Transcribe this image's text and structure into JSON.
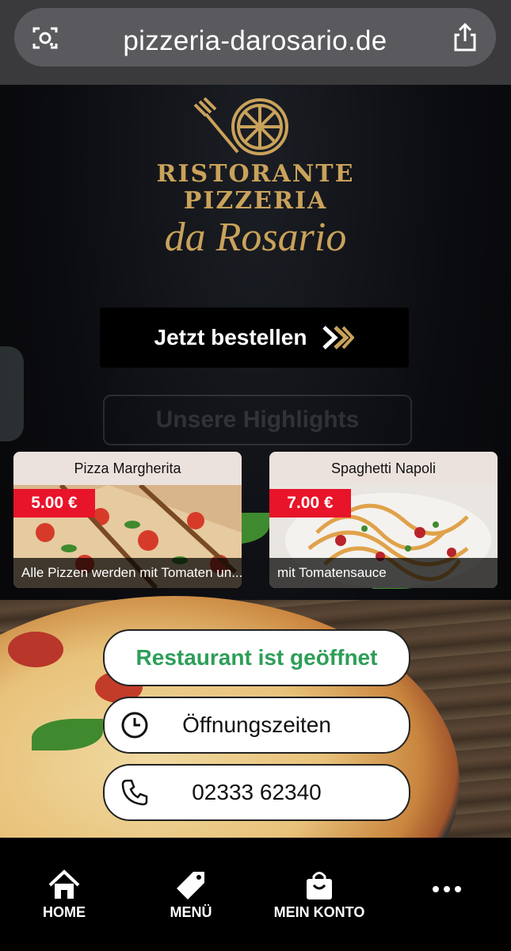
{
  "browser": {
    "url": "pizzeria-darosario.de",
    "camera_icon": "camera-search-icon",
    "share_icon": "share-icon"
  },
  "logo": {
    "line1": "RISTORANTE",
    "line2": "PIZZERIA",
    "line3": "da Rosario",
    "icon": "fork-pizza-logo-icon",
    "color": "#c9a25a"
  },
  "order_button": {
    "label": "Jetzt bestellen",
    "icon": "double-chevron-right-icon"
  },
  "highlights": {
    "label": "Unsere Highlights"
  },
  "cards": [
    {
      "title": "Pizza Margherita",
      "price": "5.00 €",
      "description": "Alle Pizzen werden mit Tomaten un..."
    },
    {
      "title": "Spaghetti Napoli",
      "price": "7.00 €",
      "description": "mit Tomatensauce"
    }
  ],
  "status": {
    "label": "Restaurant ist geöffnet",
    "color": "#2e9e58"
  },
  "hours": {
    "label": "Öffnungszeiten",
    "icon": "clock-icon"
  },
  "phone": {
    "label": "02333 62340",
    "icon": "phone-icon"
  },
  "nav": {
    "home": "HOME",
    "menu": "MENÜ",
    "account": "MEIN KONTO",
    "more_icon": "more-dots-icon"
  }
}
